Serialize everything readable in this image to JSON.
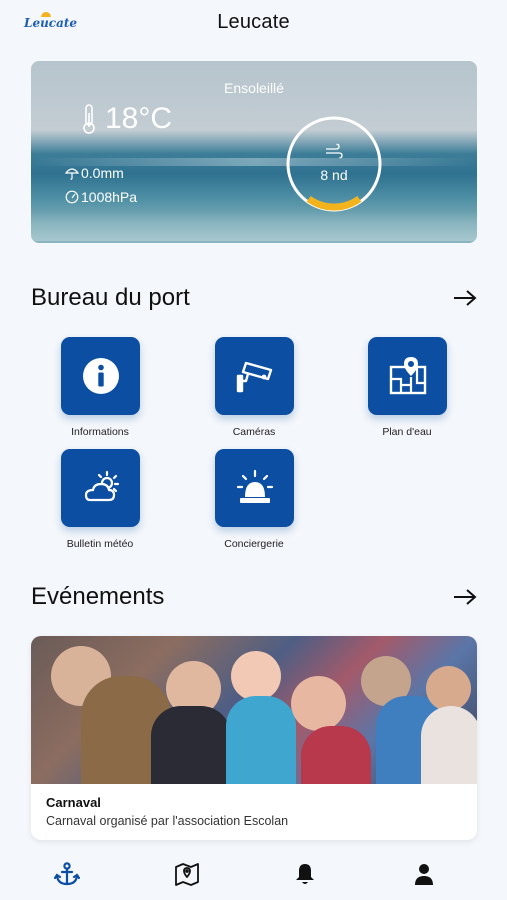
{
  "header": {
    "logo_text": "Leucate",
    "title": "Leucate"
  },
  "weather": {
    "condition": "Ensoleillé",
    "temperature": "18°C",
    "rain": "0.0mm",
    "pressure": "1008hPa",
    "wind": "8 nd",
    "wind_gauge_fraction": 0.2,
    "gauge_color": "#f2b31c"
  },
  "port_section": {
    "title": "Bureau du port",
    "tiles": [
      {
        "label": "Informations",
        "icon": "info-icon"
      },
      {
        "label": "Caméras",
        "icon": "camera-icon"
      },
      {
        "label": "Plan d'eau",
        "icon": "map-pin-icon"
      },
      {
        "label": "Bulletin météo",
        "icon": "cloud-sun-icon"
      },
      {
        "label": "Conciergerie",
        "icon": "siren-icon"
      }
    ]
  },
  "events_section": {
    "title": "Evénements",
    "card": {
      "title": "Carnaval",
      "subtitle": "Carnaval organisé par l'association Escolan"
    }
  },
  "nav": {
    "items": [
      "anchor-icon",
      "map-icon",
      "bell-icon",
      "user-icon"
    ],
    "active_color": "#0b4ea2"
  },
  "colors": {
    "primary": "#0b4ea2",
    "background": "#f4f7fb"
  }
}
